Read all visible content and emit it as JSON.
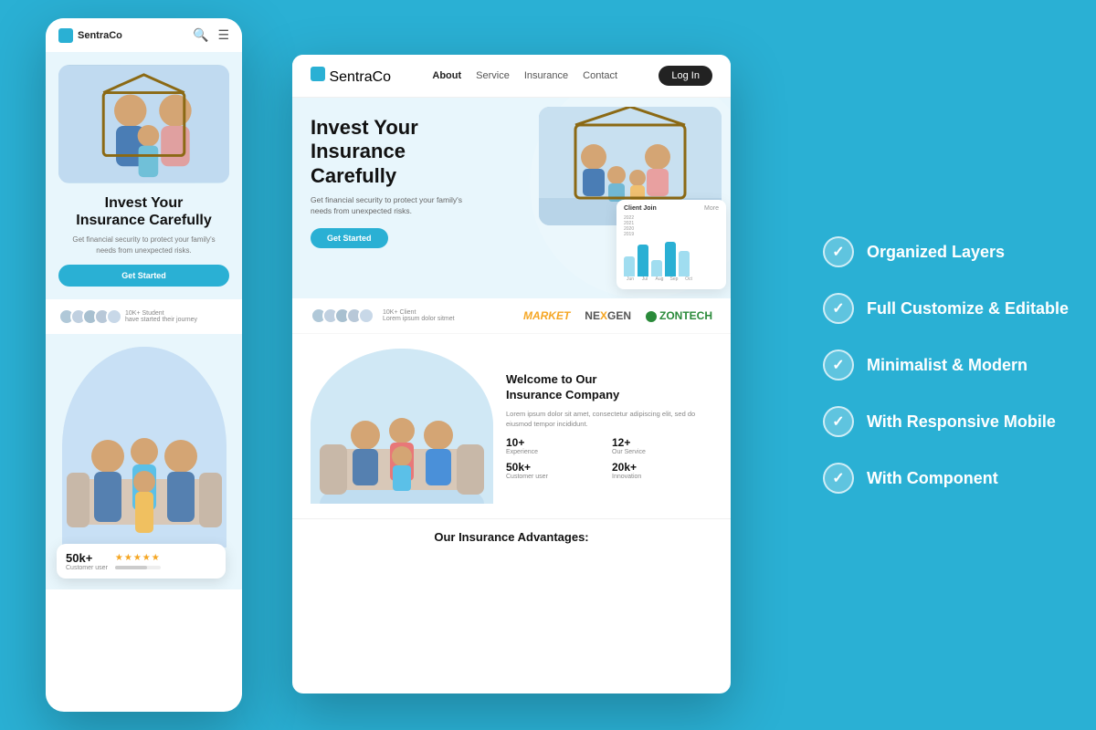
{
  "brand": {
    "name": "SentraCo",
    "logo_icon": "logo-icon"
  },
  "desktop": {
    "nav": {
      "links": [
        "About",
        "Service",
        "Insurance",
        "Contact"
      ],
      "active_link": "About",
      "login_label": "Log In"
    },
    "hero": {
      "title_line1": "Invest Your",
      "title_line2": "Insurance",
      "title_line3": "Carefully",
      "subtitle": "Get financial security to protect your family's\nneeds from unexpected risks.",
      "cta_label": "Get Started"
    },
    "chart": {
      "title": "Client Join",
      "more": "More",
      "years": [
        "2022",
        "2021",
        "2020",
        "2019"
      ],
      "months": [
        "Jun",
        "Jul",
        "Aug",
        "Sep",
        "Oct"
      ],
      "bars": [
        30,
        45,
        25,
        55,
        40
      ]
    },
    "clients": {
      "count": "10K+ Client",
      "subtitle": "Lorem ipsum dolor sitmet"
    },
    "brands": [
      "MARKET",
      "NExGEN",
      "ZONTECH"
    ],
    "welcome": {
      "title_line1": "Welcome to Our",
      "title_line2": "Insurance Company",
      "description": "Lorem ipsum dolor sit amet, consectetur adipiscing elit, sed do eiusmod tempor incididunt.",
      "stats": [
        {
          "num": "10+",
          "label": "Experience"
        },
        {
          "num": "12+",
          "label": "Our Service"
        },
        {
          "num": "50k+",
          "label": "Customer user"
        },
        {
          "num": "20k+",
          "label": "Innovation"
        }
      ]
    },
    "insurance_section": {
      "title": "Our Insurance Advantages:"
    }
  },
  "mobile": {
    "hero": {
      "title_line1": "Invest Your",
      "title_line2": "Insurance Carefully",
      "subtitle": "Get financial security to protect your family's\nneeds from unexpected risks.",
      "cta_label": "Get Started"
    },
    "clients": {
      "count": "10K+ Student",
      "subtitle": "have started their journey"
    },
    "rating": {
      "count": "50k+",
      "label": "Customer user",
      "stars": "★★★★★"
    }
  },
  "features": [
    {
      "label": "Organized Layers"
    },
    {
      "label": "Full Customize & Editable"
    },
    {
      "label": "Minimalist & Modern"
    },
    {
      "label": "With Responsive Mobile"
    },
    {
      "label": "With Component"
    }
  ],
  "colors": {
    "primary": "#2ab0d4",
    "dark": "#111111",
    "white": "#ffffff",
    "light_bg": "#e8f6fc"
  }
}
